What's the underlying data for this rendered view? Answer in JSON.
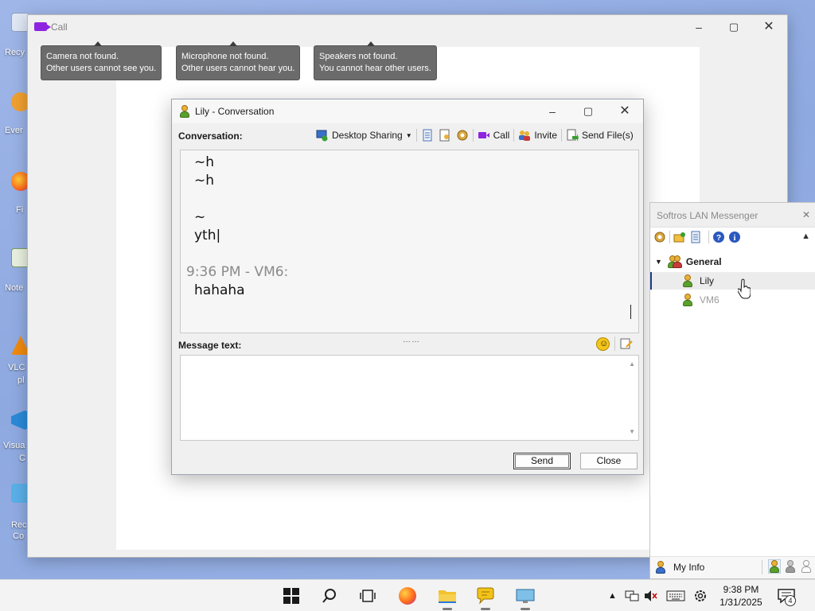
{
  "desktop": {
    "icons": [
      {
        "label": "Recy"
      },
      {
        "label": "Ever"
      },
      {
        "label": "Fi"
      },
      {
        "label": "Note"
      },
      {
        "label": "VLC"
      },
      {
        "label": "pl"
      },
      {
        "label": "Visua"
      },
      {
        "label": "C"
      },
      {
        "label": "Rec"
      },
      {
        "label": "Co"
      }
    ]
  },
  "call_window": {
    "title": "Call",
    "tooltips": [
      {
        "line1": "Camera not found.",
        "line2": "Other users cannot see you."
      },
      {
        "line1": "Microphone not found.",
        "line2": "Other users cannot hear you."
      },
      {
        "line1": "Speakers not found.",
        "line2": "You cannot hear other users."
      }
    ]
  },
  "conversation": {
    "title": "Lily - Conversation",
    "label": "Conversation:",
    "toolbar": {
      "desktop_sharing": "Desktop Sharing",
      "call": "Call",
      "invite": "Invite",
      "send_files": "Send File(s)"
    },
    "transcript": {
      "lines_before": [
        "~h",
        "~h",
        "",
        "~",
        "yth|"
      ],
      "entries": [
        {
          "stamp": "9:36 PM - VM6:",
          "text": "hahaha"
        }
      ]
    },
    "message_label": "Message text:",
    "message_value": "",
    "send_label": "Send",
    "close_label": "Close"
  },
  "lan_messenger": {
    "title": "Softros LAN Messenger",
    "group": "General",
    "users": [
      {
        "name": "Lily",
        "status": "online",
        "selected": true
      },
      {
        "name": "VM6",
        "status": "offline",
        "selected": false
      }
    ],
    "my_info": "My Info"
  },
  "taskbar": {
    "time": "9:38 PM",
    "date": "1/31/2025",
    "notification_count": "4"
  },
  "colors": {
    "accent": "#1e3e8a",
    "call_icon": "#8e24e0",
    "tooltip_bg": "#6b6b6b"
  }
}
